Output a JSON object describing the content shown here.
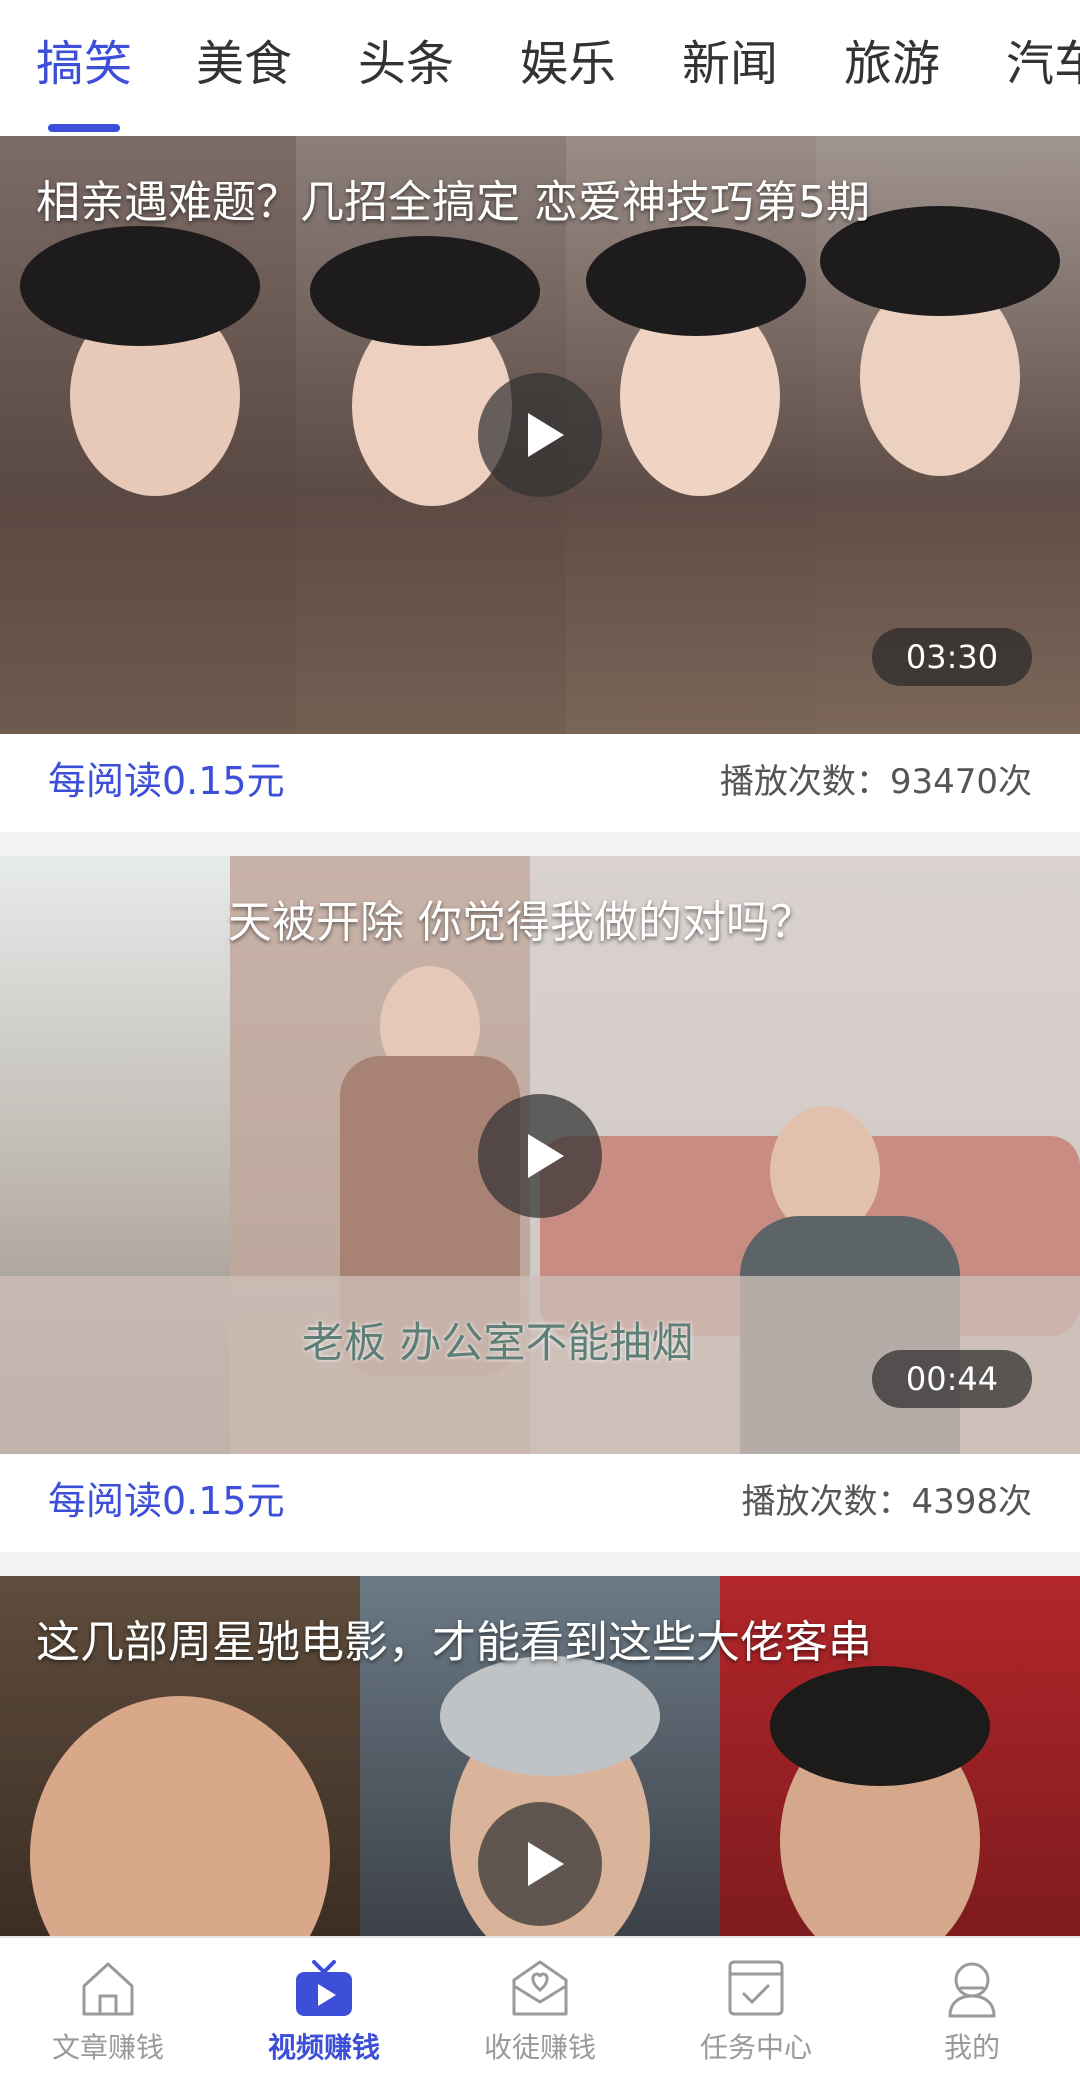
{
  "tabs": [
    "搞笑",
    "美食",
    "头条",
    "娱乐",
    "新闻",
    "旅游",
    "汽车"
  ],
  "active_tab_index": 0,
  "videos": [
    {
      "title": "相亲遇难题？几招全搞定 恋爱神技巧第5期",
      "duration": "03:30",
      "reward": "每阅读0.15元",
      "play_count": "播放次数：93470次"
    },
    {
      "title": "天被开除 你觉得我做的对吗？",
      "caption": "老板 办公室不能抽烟",
      "duration": "00:44",
      "reward": "每阅读0.15元",
      "play_count": "播放次数：4398次"
    },
    {
      "title": "这几部周星驰电影，才能看到这些大佬客串"
    }
  ],
  "bottom_nav": [
    {
      "label": "文章赚钱",
      "icon": "home-icon"
    },
    {
      "label": "视频赚钱",
      "icon": "tv-play-icon"
    },
    {
      "label": "收徒赚钱",
      "icon": "heart-mail-icon"
    },
    {
      "label": "任务中心",
      "icon": "task-check-icon"
    },
    {
      "label": "我的",
      "icon": "profile-icon"
    }
  ],
  "active_nav_index": 1,
  "colors": {
    "accent": "#3d4fd8",
    "inactive_nav": "#9a9a9a"
  }
}
